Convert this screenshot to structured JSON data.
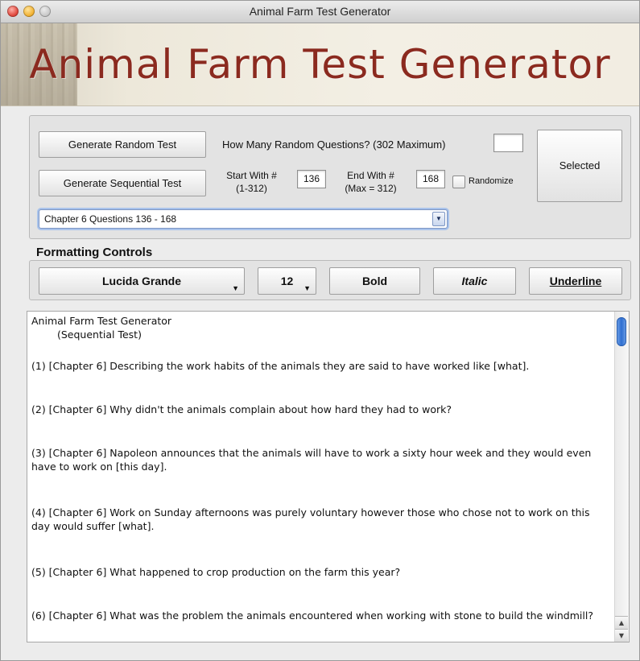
{
  "window": {
    "title": "Animal Farm Test Generator"
  },
  "banner": {
    "title": "Animal Farm Test Generator"
  },
  "controls": {
    "random_button": "Generate Random Test",
    "how_many_label": "How Many Random Questions? (302 Maximum)",
    "how_many_value": "",
    "selected_button": "Selected",
    "sequential_button": "Generate Sequential Test",
    "start_label": "Start With #",
    "start_range": "(1-312)",
    "start_value": "136",
    "end_label": "End With #",
    "end_range": "(Max = 312)",
    "end_value": "168",
    "randomize_label": "Randomize",
    "randomize_checked": false,
    "chapter_select": "Chapter 6  Questions 136 - 168"
  },
  "formatting": {
    "title": "Formatting Controls",
    "font": "Lucida Grande",
    "size": "12",
    "bold": "Bold",
    "italic": "Italic",
    "underline": "Underline"
  },
  "document": {
    "heading": "Animal Farm Test Generator",
    "subheading": "(Sequential Test)",
    "questions": [
      "(1)  [Chapter 6] Describing the work habits of the animals they are said to have worked like [what].",
      "(2)  [Chapter 6] Why didn't the animals complain about how hard they had to work?",
      "(3)  [Chapter 6] Napoleon announces that the animals will have to work a sixty hour week and they would even have to work on [this day].",
      "(4)  [Chapter 6] Work on Sunday afternoons was purely voluntary however those who chose not to work on this day would suffer [what].",
      "(5)  [Chapter 6] What happened to crop production on the farm this year?",
      "(6)  [Chapter 6] What was the problem the animals encountered when working with stone to build the windmill?"
    ]
  },
  "colors": {
    "banner_title": "#8b2a1f",
    "accent": "#2f6fd1"
  },
  "icons": {
    "select_arrow": "chevron-down-icon",
    "scroll_up": "arrow-up-icon",
    "scroll_down": "arrow-down-icon"
  }
}
